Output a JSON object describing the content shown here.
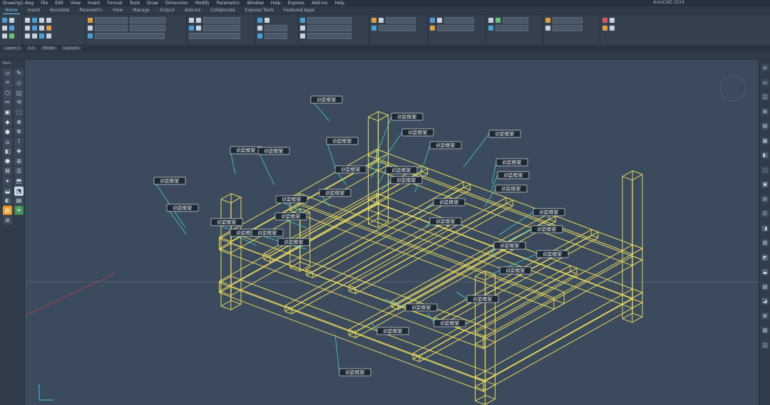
{
  "app": {
    "title": "AutoCAD 2024"
  },
  "menu": {
    "items": [
      "Drawing1.dwg",
      "File",
      "Edit",
      "View",
      "Insert",
      "Format",
      "Tools",
      "Draw",
      "Dimension",
      "Modify",
      "Parametric",
      "Window",
      "Help",
      "Express",
      "Add-ins",
      "Help"
    ]
  },
  "tabs": [
    "Home",
    "Insert",
    "Annotate",
    "Parametric",
    "View",
    "Manage",
    "Output",
    "Add-ins",
    "Collaborate",
    "Express Tools",
    "Featured Apps"
  ],
  "status": {
    "items": [
      "Layer 1",
      "1:1",
      "Model",
      "Layout1"
    ]
  },
  "palette": {
    "heading": "Tools"
  },
  "drawing": {
    "callouts": [
      "Ø梁框架",
      "Ø梁框架",
      "Ø梁框架",
      "Ø梁框架",
      "Ø梁框架",
      "Ø梁框架",
      "Ø梁框架",
      "Ø梁框架",
      "Ø梁框架",
      "Ø梁框架",
      "Ø梁框架",
      "Ø梁框架",
      "Ø梁框架",
      "Ø梁框架",
      "Ø梁框架",
      "Ø梁框架",
      "Ø梁框架",
      "Ø梁框架",
      "Ø梁框架",
      "Ø梁框架",
      "Ø梁框架",
      "Ø梁框架",
      "Ø梁框架",
      "Ø梁框架",
      "Ø梁框架",
      "Ø梁框架",
      "Ø梁框架",
      "Ø梁框架",
      "Ø梁框架",
      "Ø梁框架"
    ],
    "colors": {
      "frame": "#e6d860",
      "leader": "#49d0c6",
      "tag_bg": "#1e2833",
      "tag_border": "#cfd8e2",
      "background": "#3b4a5c"
    }
  }
}
